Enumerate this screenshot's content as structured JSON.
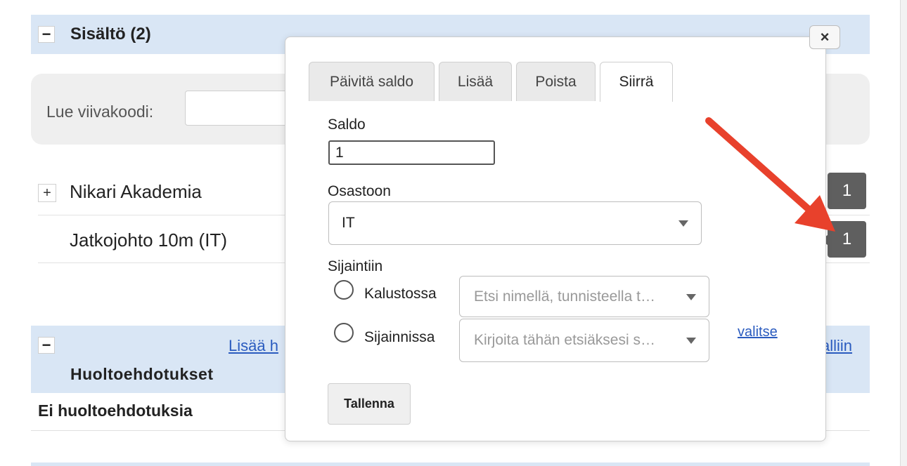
{
  "content_section": {
    "toggle": "−",
    "title": "Sisältö (2)"
  },
  "barcode": {
    "label": "Lue viivakoodi:",
    "value": ""
  },
  "items": [
    {
      "toggle": "+",
      "name": "Nikari Akademia",
      "count": "1"
    },
    {
      "name": "Jatkojohto 10m (IT)",
      "count": "1"
    }
  ],
  "maintenance_section": {
    "toggle": "−",
    "title": "Huoltoehdotukset",
    "link_add": "Lisää h",
    "link_all": "alliin",
    "empty_text": "Ei huoltoehdotuksia"
  },
  "modal": {
    "close": "×",
    "tabs": [
      {
        "label": "Päivitä saldo",
        "active": false
      },
      {
        "label": "Lisää",
        "active": false
      },
      {
        "label": "Poista",
        "active": false
      },
      {
        "label": "Siirrä",
        "active": true
      }
    ],
    "saldo_label": "Saldo",
    "saldo_value": "1",
    "osasto_label": "Osastoon",
    "osasto_value": "IT",
    "sijainti_label": "Sijaintiin",
    "radio_kalustossa": "Kalustossa",
    "radio_sijainnissa": "Sijainnissa",
    "kalusto_placeholder": "Etsi nimellä, tunnisteella t…",
    "sijainti_placeholder": "Kirjoita tähän etsiäksesi s…",
    "valitse": "valitse",
    "save": "Tallenna"
  },
  "colors": {
    "section_bg": "#d9e6f5",
    "link": "#2a5bbf",
    "badge": "#5f5f5f",
    "annotation_arrow": "#e8412c"
  }
}
